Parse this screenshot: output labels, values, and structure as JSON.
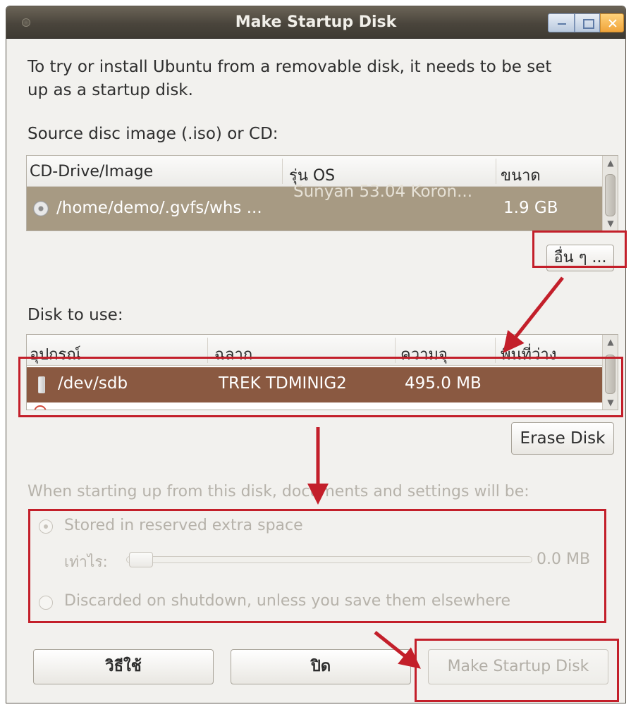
{
  "window": {
    "title": "Make Startup Disk"
  },
  "intro": {
    "line1": "To try or install Ubuntu from a removable disk, it needs to be set",
    "line2": "up as a startup disk."
  },
  "source": {
    "label": "Source disc image (.iso) or CD:",
    "columns": [
      "CD-Drive/Image",
      "รุ่น OS",
      "ขนาด"
    ],
    "rows": [
      {
        "image": "/home/demo/.gvfs/whs ...",
        "os": "Sunyan 53.04 Koron...",
        "size": "1.9 GB",
        "icon": "cd-icon"
      }
    ],
    "other_button": "อื่น ๆ ..."
  },
  "disk": {
    "label": "Disk to use:",
    "columns": [
      "อุปกรณ์",
      "ฉลาก",
      "ความจุ",
      "พื้นที่ว่าง"
    ],
    "rows": [
      {
        "device": "/dev/sdb",
        "label": "TREK TDMINIG2",
        "capacity": "495.0 MB",
        "free": "",
        "icon": "usb-drive-icon"
      }
    ],
    "erase_button": "Erase Disk"
  },
  "persistence": {
    "label": "When starting up from this disk, documents and settings will be:",
    "option_stored": "Stored in reserved extra space",
    "size_label": "เท่าไร:",
    "size_value": "0.0 MB",
    "option_discarded": "Discarded on shutdown, unless you save them elsewhere",
    "selected": "stored"
  },
  "footer": {
    "help_button": "วิธีใช้",
    "close_button": "ปิด",
    "make_button": "Make Startup Disk"
  },
  "colors": {
    "selection_source": "#a79a83",
    "selection_disk": "#8a5941",
    "annotation": "#c31f2a"
  }
}
